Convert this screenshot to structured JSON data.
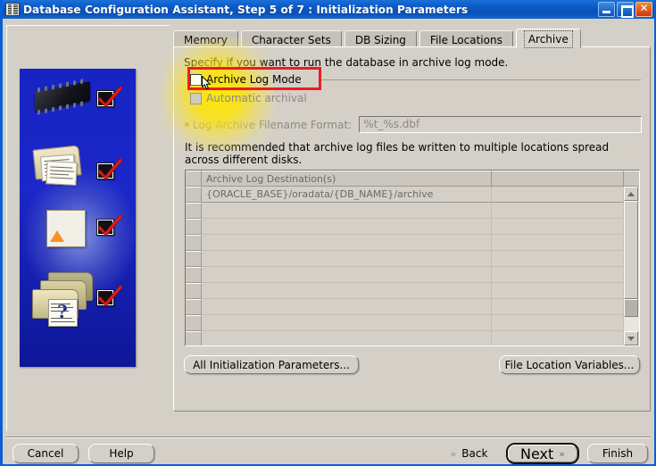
{
  "window": {
    "title": "Database Configuration Assistant, Step 5 of 7 : Initialization Parameters",
    "icon": "database-icon",
    "buttons": {
      "minimize": "minimize-button",
      "maximize": "maximize-button",
      "close": "close-button"
    }
  },
  "tabs": [
    {
      "label": "Memory",
      "selected": false
    },
    {
      "label": "Character Sets",
      "selected": false
    },
    {
      "label": "DB Sizing",
      "selected": false
    },
    {
      "label": "File Locations",
      "selected": false
    },
    {
      "label": "Archive",
      "selected": true
    }
  ],
  "archive_panel": {
    "specify_text": "Specify if you want to run the database in archive log mode.",
    "archive_log_mode": {
      "label": "Archive Log Mode",
      "checked": false,
      "highlighted": true
    },
    "automatic_archival": {
      "label": "Automatic archival",
      "checked": false,
      "disabled": true
    },
    "filename_format": {
      "label": "Log Archive Filename Format:",
      "value": "%t_%s.dbf",
      "disabled": true
    },
    "recommendation_line1": "It is recommended that archive log files be written to multiple locations spread",
    "recommendation_line2": "across different disks.",
    "table": {
      "columns": [
        "Archive Log Destination(s)",
        ""
      ],
      "rows": [
        [
          "{ORACLE_BASE}/oradata/{DB_NAME}/archive",
          ""
        ],
        [
          "",
          ""
        ],
        [
          "",
          ""
        ],
        [
          "",
          ""
        ],
        [
          "",
          ""
        ],
        [
          "",
          ""
        ],
        [
          "",
          ""
        ],
        [
          "",
          ""
        ],
        [
          "",
          ""
        ]
      ]
    },
    "all_parameters_button": "All Initialization Parameters...",
    "file_location_variables_button": "File Location Variables..."
  },
  "footer": {
    "cancel": "Cancel",
    "help": "Help",
    "back": "Back",
    "back_chevron": "«",
    "next": "Next",
    "next_chevron": "»",
    "finish": "Finish"
  },
  "colors": {
    "titlebar_blue": "#0c59c4",
    "face": "#d4d0c8",
    "highlight_red": "#ee1b24",
    "highlight_yellow": "#ffe800",
    "splash_blue": "#1724c4",
    "accent_orange": "#f79325"
  }
}
